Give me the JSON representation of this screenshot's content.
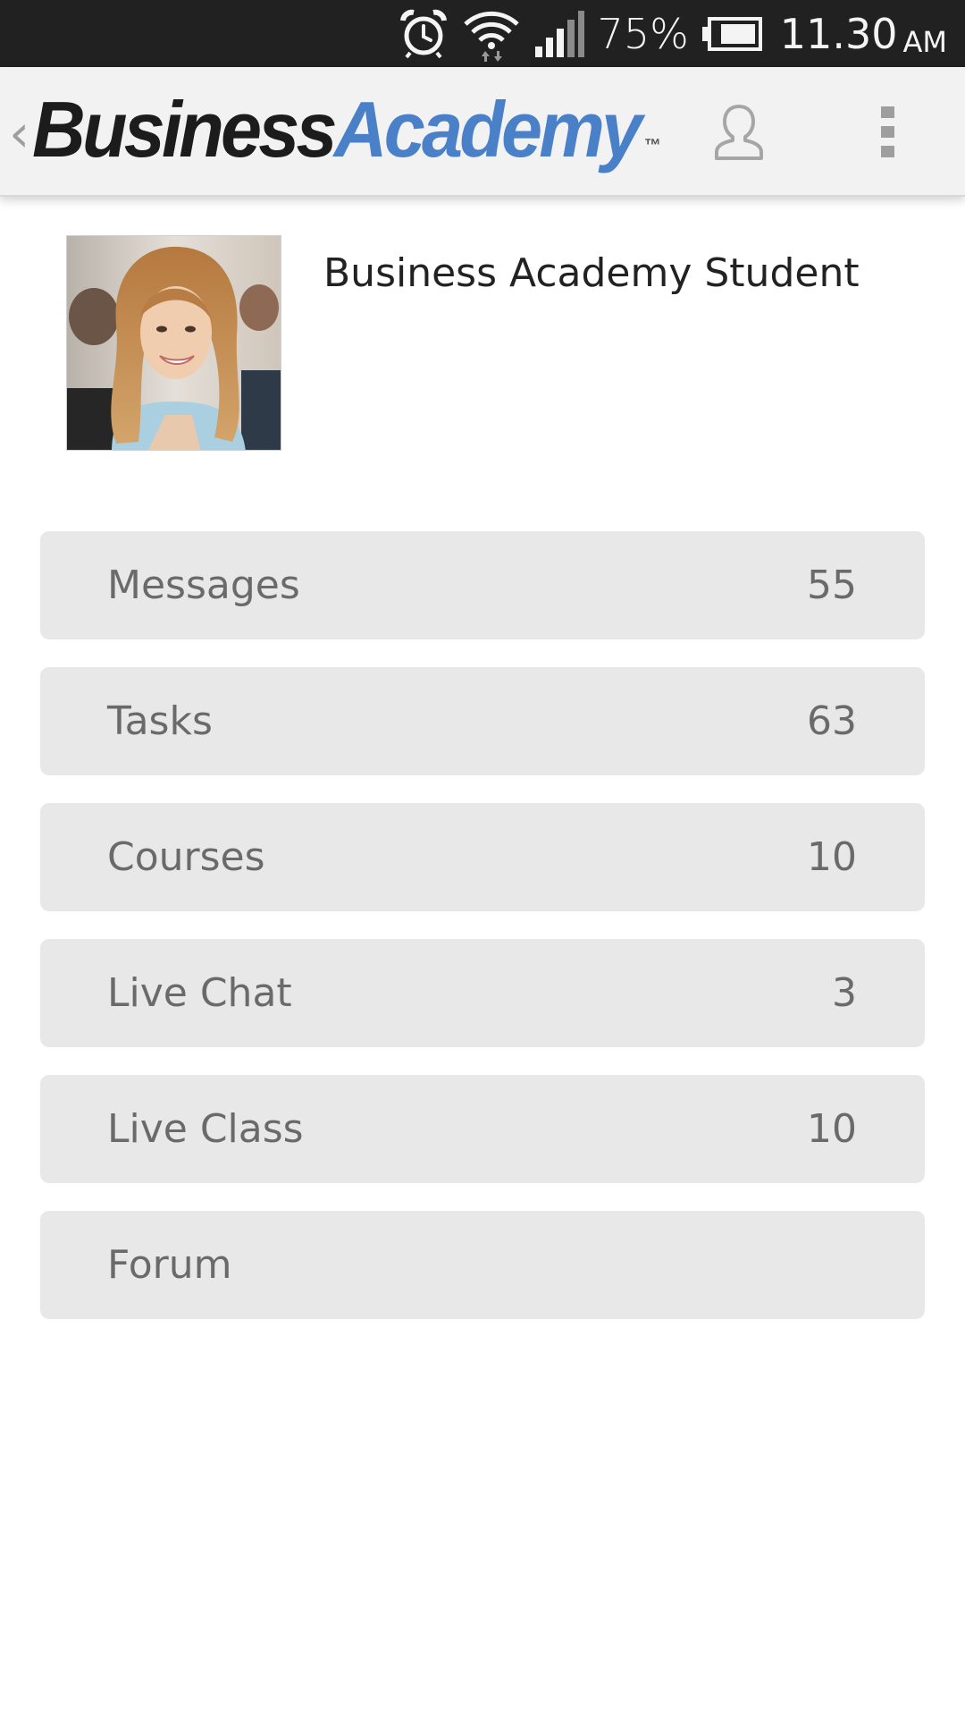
{
  "status_bar": {
    "battery_percent": "75%",
    "time": "11.30",
    "ampm": "AM",
    "icons": [
      "alarm-icon",
      "wifi-icon",
      "signal-icon",
      "battery-icon"
    ]
  },
  "app_bar": {
    "logo_part1": "Business",
    "logo_part2": "Academy",
    "logo_tm": "™",
    "back_glyph": "‹",
    "colors": {
      "logo_dark": "#1c1c1c",
      "logo_blue": "#4a80c8"
    }
  },
  "profile": {
    "name": "Business Academy Student"
  },
  "menu": {
    "items": [
      {
        "label": "Messages",
        "count": "55"
      },
      {
        "label": "Tasks",
        "count": "63"
      },
      {
        "label": "Courses",
        "count": "10"
      },
      {
        "label": "Live Chat",
        "count": "3"
      },
      {
        "label": "Live Class",
        "count": "10"
      },
      {
        "label": "Forum",
        "count": ""
      }
    ]
  }
}
